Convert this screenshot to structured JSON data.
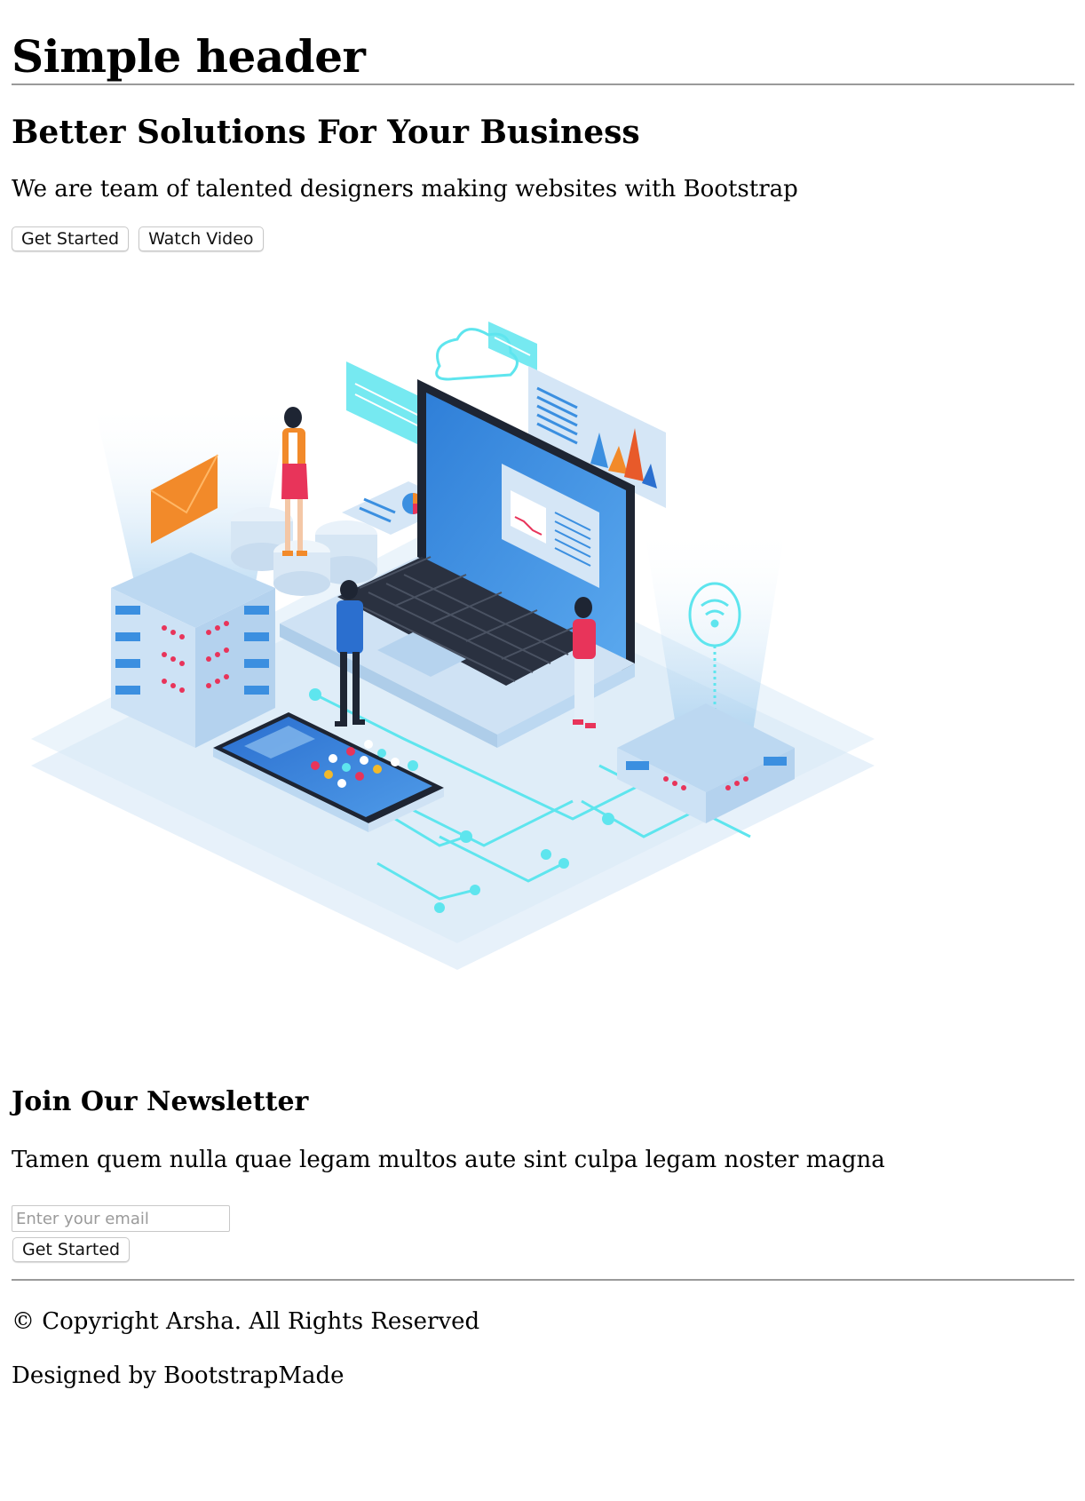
{
  "header": {
    "title": "Simple header"
  },
  "hero": {
    "title": "Better Solutions For Your Business",
    "subtitle": "We are team of talented designers making websites with Bootstrap",
    "primary_button": "Get Started",
    "secondary_button": "Watch Video",
    "illustration": "isometric-tech-illustration"
  },
  "newsletter": {
    "title": "Join Our Newsletter",
    "text": "Tamen quem nulla quae legam multos aute sint culpa legam noster magna",
    "email_placeholder": "Enter your email",
    "email_value": "",
    "submit_label": "Get Started"
  },
  "footer": {
    "copyright": "© Copyright Arsha. All Rights Reserved",
    "credits": "Designed by BootstrapMade"
  },
  "colors": {
    "accent_blue": "#3b8fe0",
    "light_blue": "#cfe4f5",
    "cyan": "#59e3f0",
    "orange": "#f28a2a",
    "pink": "#e8345a"
  }
}
